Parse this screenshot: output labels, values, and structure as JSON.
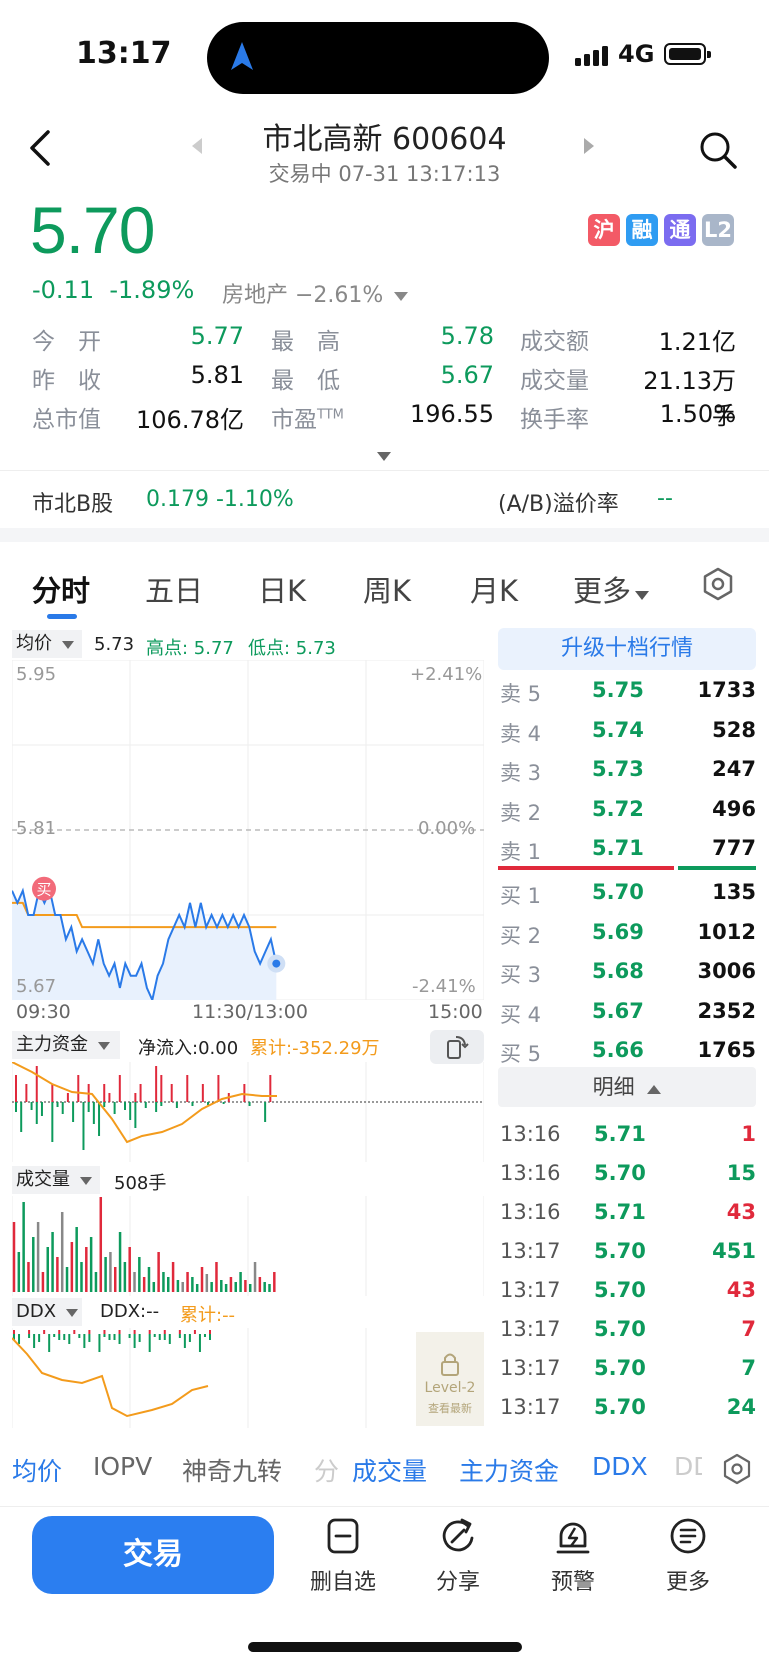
{
  "status_bar": {
    "time": "13:17",
    "network": "4G"
  },
  "header": {
    "title": "市北高新 600604",
    "trade_status": "交易中 07-31 13:17:13"
  },
  "quote": {
    "price": "5.70",
    "change": "-0.11",
    "change_pct": "-1.89%",
    "sector": "房地产 −2.61%",
    "badges": [
      {
        "label": "沪",
        "color": "#f35a66"
      },
      {
        "label": "融",
        "color": "#2f9cf2"
      },
      {
        "label": "通",
        "color": "#7b6cf0"
      },
      {
        "label": "L2",
        "color": "#a9b6c9"
      }
    ]
  },
  "stats": [
    {
      "label": "今　开",
      "value": "5.77",
      "tone": "green"
    },
    {
      "label": "最　高",
      "value": "5.78",
      "tone": "green"
    },
    {
      "label": "成交额",
      "value": "1.21亿",
      "tone": "dark"
    },
    {
      "label": "昨　收",
      "value": "5.81",
      "tone": "dark"
    },
    {
      "label": "最　低",
      "value": "5.67",
      "tone": "green"
    },
    {
      "label": "成交量",
      "value": "21.13万手",
      "tone": "dark"
    },
    {
      "label": "总市值",
      "value": "106.78亿",
      "tone": "dark"
    },
    {
      "label": "市盈",
      "sup": "TTM",
      "value": "196.55",
      "tone": "dark"
    },
    {
      "label": "换手率",
      "value": "1.50%",
      "tone": "dark"
    }
  ],
  "b_share": {
    "label": "市北B股",
    "price": "0.179 -1.10%",
    "ab_label": "(A/B)溢价率",
    "ab_value": "--"
  },
  "tabs": [
    "分时",
    "五日",
    "日K",
    "周K",
    "月K",
    "更多"
  ],
  "chart_header": {
    "dropdown": "均价",
    "avg": "5.73",
    "high": "高点: 5.77",
    "low": "低点: 5.73"
  },
  "chart_data": {
    "type": "line",
    "y_labels_left": [
      "5.95",
      "5.81",
      "5.67"
    ],
    "y_labels_right": [
      "+2.41%",
      "0.00%",
      "-2.41%"
    ],
    "x_labels": [
      "09:30",
      "11:30/13:00",
      "15:00"
    ],
    "ylim": [
      5.67,
      5.95
    ],
    "prev_close": 5.81,
    "buy_marker": "买",
    "price_series": [
      5.76,
      5.75,
      5.76,
      5.74,
      5.74,
      5.76,
      5.75,
      5.76,
      5.74,
      5.74,
      5.72,
      5.73,
      5.71,
      5.72,
      5.71,
      5.7,
      5.72,
      5.7,
      5.69,
      5.7,
      5.68,
      5.7,
      5.69,
      5.69,
      5.7,
      5.68,
      5.67,
      5.69,
      5.7,
      5.72,
      5.73,
      5.74,
      5.73,
      5.75,
      5.73,
      5.75,
      5.73,
      5.74,
      5.73,
      5.74,
      5.73,
      5.74,
      5.73,
      5.74,
      5.73,
      5.71,
      5.7,
      5.71,
      5.72,
      5.7
    ],
    "avg_series": [
      5.75,
      5.75,
      5.75,
      5.74,
      5.74,
      5.74,
      5.74,
      5.74,
      5.74,
      5.74,
      5.74,
      5.74,
      5.74,
      5.73,
      5.73,
      5.73,
      5.73,
      5.73,
      5.73,
      5.73,
      5.73,
      5.73,
      5.73,
      5.73,
      5.73,
      5.73,
      5.73,
      5.73,
      5.73,
      5.73,
      5.73,
      5.73,
      5.73,
      5.73,
      5.73,
      5.73,
      5.73,
      5.73,
      5.73,
      5.73,
      5.73,
      5.73,
      5.73,
      5.73,
      5.73,
      5.73,
      5.73,
      5.73,
      5.73,
      5.73
    ]
  },
  "capital_panel": {
    "dropdown": "主力资金",
    "net": "净流入:0.00",
    "cumulative": "累计:-352.29万"
  },
  "volume_panel": {
    "dropdown": "成交量",
    "value": "508手"
  },
  "ddx_panel": {
    "dropdown": "DDX",
    "value": "DDX:--",
    "cumulative": "累计:--",
    "locked_title": "Level-2",
    "locked_sub": "查看最新"
  },
  "order_book": {
    "upgrade_label": "升级十档行情",
    "asks": [
      {
        "label": "卖 5",
        "price": "5.75",
        "vol": "1733"
      },
      {
        "label": "卖 4",
        "price": "5.74",
        "vol": "528"
      },
      {
        "label": "卖 3",
        "price": "5.73",
        "vol": "247"
      },
      {
        "label": "卖 2",
        "price": "5.72",
        "vol": "496"
      },
      {
        "label": "卖 1",
        "price": "5.71",
        "vol": "777"
      }
    ],
    "bids": [
      {
        "label": "买 1",
        "price": "5.70",
        "vol": "135"
      },
      {
        "label": "买 2",
        "price": "5.69",
        "vol": "1012"
      },
      {
        "label": "买 3",
        "price": "5.68",
        "vol": "3006"
      },
      {
        "label": "买 4",
        "price": "5.67",
        "vol": "2352"
      },
      {
        "label": "买 5",
        "price": "5.66",
        "vol": "1765"
      }
    ]
  },
  "ticks": {
    "header": "明细",
    "rows": [
      {
        "time": "13:16",
        "price": "5.71",
        "vol": "1",
        "color": "red"
      },
      {
        "time": "13:16",
        "price": "5.70",
        "vol": "15",
        "color": "green"
      },
      {
        "time": "13:16",
        "price": "5.71",
        "vol": "43",
        "color": "red"
      },
      {
        "time": "13:17",
        "price": "5.70",
        "vol": "451",
        "color": "green"
      },
      {
        "time": "13:17",
        "price": "5.70",
        "vol": "43",
        "color": "red"
      },
      {
        "time": "13:17",
        "price": "5.70",
        "vol": "7",
        "color": "red"
      },
      {
        "time": "13:17",
        "price": "5.70",
        "vol": "7",
        "color": "green"
      },
      {
        "time": "13:17",
        "price": "5.70",
        "vol": "24",
        "color": "green"
      }
    ]
  },
  "indicators": [
    {
      "label": "均价",
      "active": true
    },
    {
      "label": "IOPV",
      "active": false
    },
    {
      "label": "神奇九转",
      "active": false
    },
    {
      "label": "分",
      "active": false
    },
    {
      "label": "成交量",
      "active": true
    },
    {
      "label": "主力资金",
      "active": true
    },
    {
      "label": "DDX",
      "active": true
    },
    {
      "label": "DD",
      "active": false
    }
  ],
  "bottom_bar": {
    "trade": "交易",
    "items": [
      {
        "label": "删自选",
        "icon": "remove-watchlist-icon"
      },
      {
        "label": "分享",
        "icon": "share-icon"
      },
      {
        "label": "预警",
        "icon": "alert-icon"
      },
      {
        "label": "更多",
        "icon": "more-icon"
      }
    ]
  }
}
